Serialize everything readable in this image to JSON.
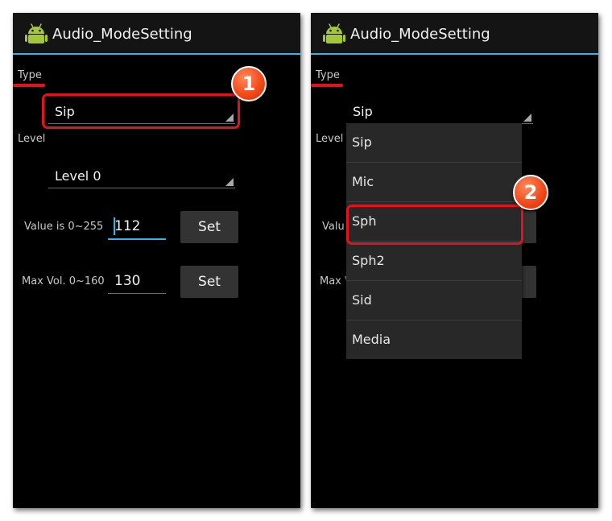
{
  "app": {
    "title": "Audio_ModeSetting",
    "icon": "android-robot-icon",
    "accent_color": "#33b5e5"
  },
  "left_screen": {
    "type_label": "Type",
    "type_value": "Sip",
    "level_label": "Level",
    "level_value": "Level 0",
    "value_row": {
      "label": "Value is 0~255",
      "value": "112",
      "button": "Set"
    },
    "max_vol_row": {
      "label": "Max Vol. 0~160",
      "value": "130",
      "button": "Set"
    }
  },
  "right_screen": {
    "type_label": "Type",
    "type_value": "Sip",
    "level_label": "Level",
    "value_label_partial": "Valu",
    "max_vol_label_partial": "Max V",
    "dropdown_options": [
      "Sip",
      "Mic",
      "Sph",
      "Sph2",
      "Sid",
      "Media"
    ],
    "highlighted_option": "Sph"
  },
  "annotations": {
    "step_1": "1",
    "step_2": "2",
    "highlight_color": "#e1141b"
  }
}
